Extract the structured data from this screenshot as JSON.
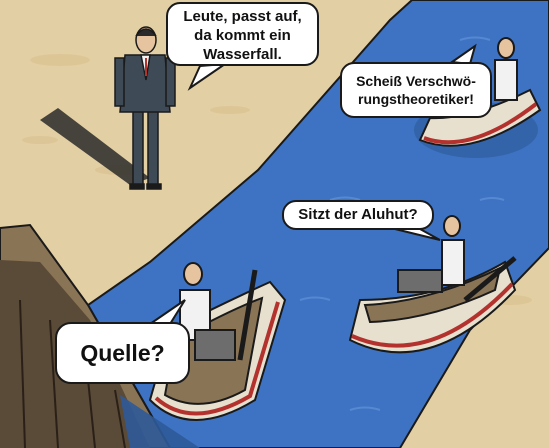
{
  "bubbles": {
    "man": {
      "lines": [
        "Leute, passt auf,",
        "da kommt ein",
        "Wasserfall."
      ]
    },
    "top_boat": {
      "lines": [
        "Scheiß Verschwö-",
        "rungstheoretiker!"
      ]
    },
    "middle_boat": {
      "lines": [
        "Sitzt der Aluhut?"
      ]
    },
    "front_boat": {
      "lines": [
        "Quelle?"
      ]
    }
  },
  "colors": {
    "sand": "#e3cfa4",
    "river": "#3d73c2",
    "cliff": "#8a7456",
    "boat_hull": "#e8e0cf",
    "boat_stripe": "#b4322e",
    "suit": "#3e4a56",
    "shirt": "#f2f2f2"
  }
}
